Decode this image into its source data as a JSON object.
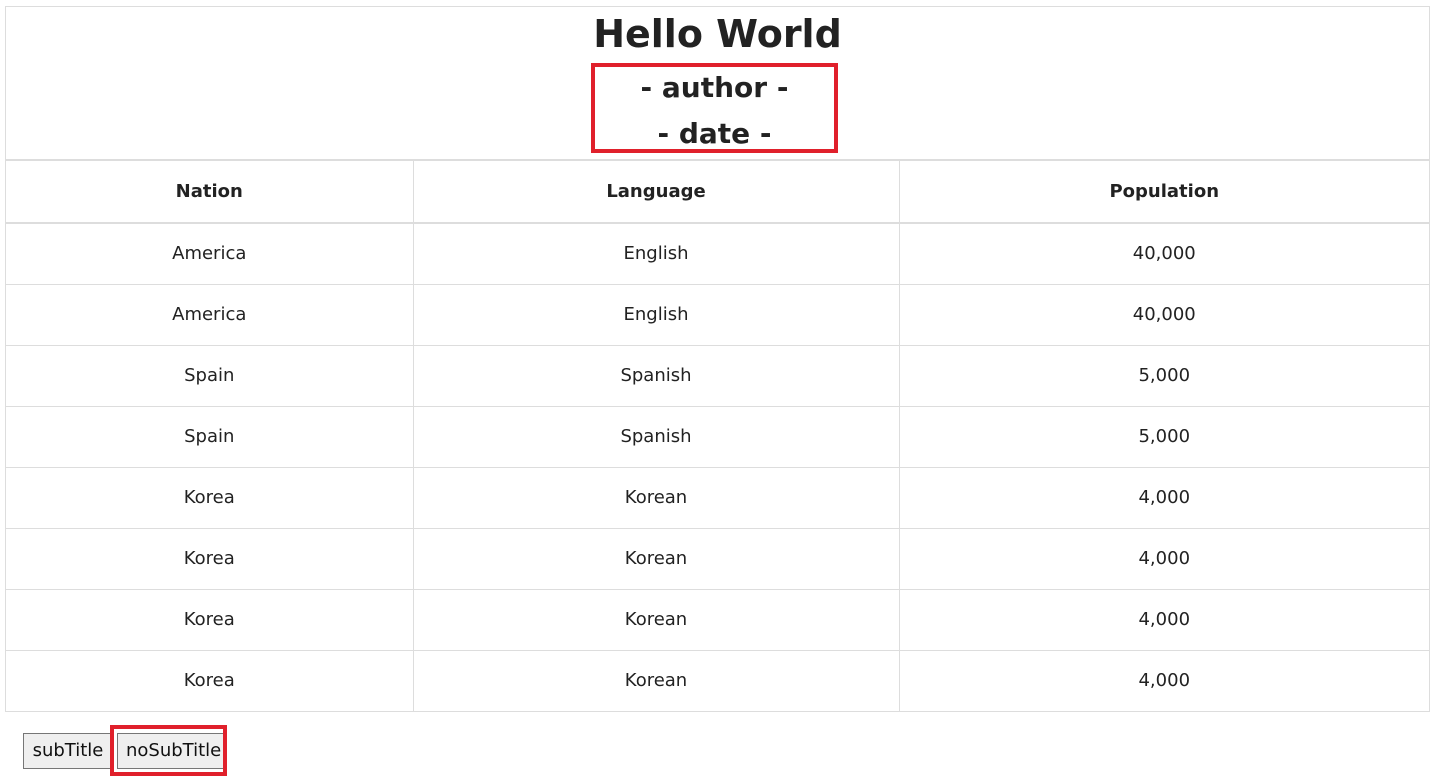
{
  "header": {
    "title": "Hello World",
    "author": "- author -",
    "date": "- date -"
  },
  "table": {
    "columns": [
      "Nation",
      "Language",
      "Population"
    ],
    "rows": [
      [
        "America",
        "English",
        "40,000"
      ],
      [
        "America",
        "English",
        "40,000"
      ],
      [
        "Spain",
        "Spanish",
        "5,000"
      ],
      [
        "Spain",
        "Spanish",
        "5,000"
      ],
      [
        "Korea",
        "Korean",
        "4,000"
      ],
      [
        "Korea",
        "Korean",
        "4,000"
      ],
      [
        "Korea",
        "Korean",
        "4,000"
      ],
      [
        "Korea",
        "Korean",
        "4,000"
      ]
    ]
  },
  "buttons": {
    "subtitle": "subTitle",
    "nosubtitle": "noSubTitle"
  },
  "colors": {
    "highlight": "#e0202b",
    "border": "#dddddd"
  }
}
